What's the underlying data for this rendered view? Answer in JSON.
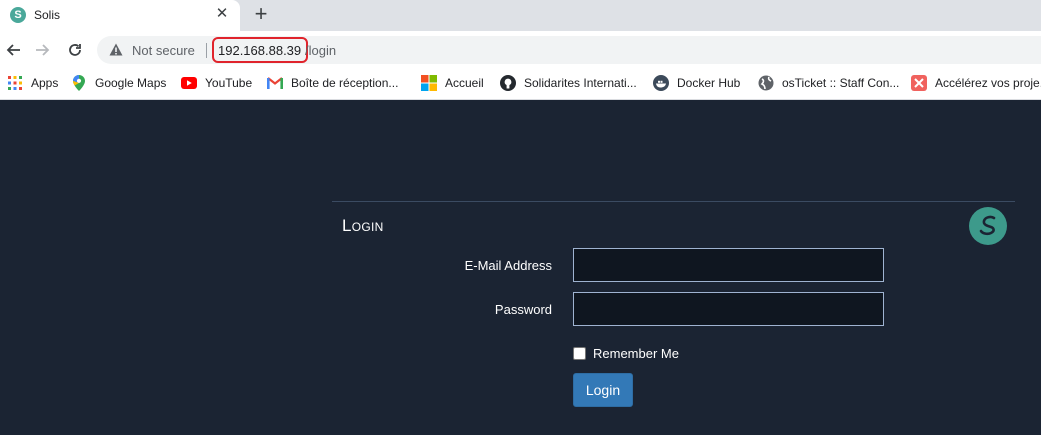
{
  "browser": {
    "tab": {
      "title": "Solis",
      "favicon": "S"
    },
    "address": {
      "security_label": "Not secure",
      "host": "192.168.88.39",
      "path": "/login"
    },
    "bookmarks": [
      {
        "label": "Apps",
        "icon": "apps-grid-icon"
      },
      {
        "label": "Google Maps",
        "icon": "maps-pin-icon"
      },
      {
        "label": "YouTube",
        "icon": "youtube-icon"
      },
      {
        "label": "Boîte de réception...",
        "icon": "gmail-icon"
      },
      {
        "label": "Accueil",
        "icon": "windows-icon"
      },
      {
        "label": "Solidarites Internati...",
        "icon": "github-icon"
      },
      {
        "label": "Docker Hub",
        "icon": "docker-icon"
      },
      {
        "label": "osTicket :: Staff Con...",
        "icon": "globe-icon"
      },
      {
        "label": "Accélérez vos proje...",
        "icon": "app-icon"
      }
    ]
  },
  "login": {
    "title": "Login",
    "email_label": "E-Mail Address",
    "email_value": "",
    "password_label": "Password",
    "password_value": "",
    "remember_label": "Remember Me",
    "submit_label": "Login"
  },
  "colors": {
    "page_background": "#1b2433",
    "primary_button": "#3379b7",
    "logo": "#3d9a8b",
    "url_highlight": "#e0242c"
  }
}
